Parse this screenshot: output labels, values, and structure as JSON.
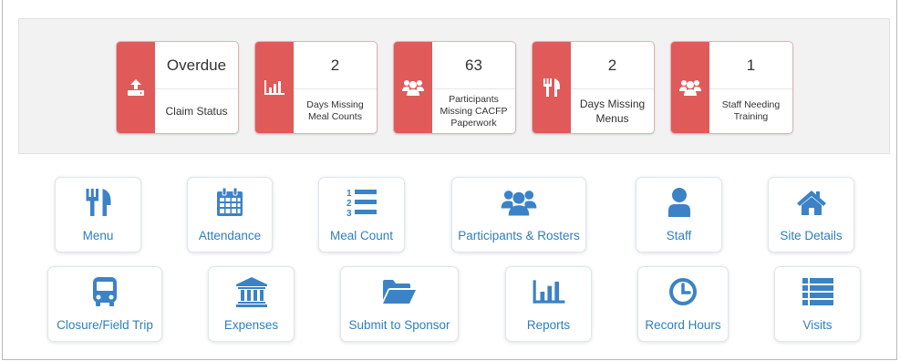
{
  "colors": {
    "accent_red": "#e05a5a",
    "link_blue": "#2f7ec0",
    "icon_blue": "#3b82c6",
    "panel_bg": "#f2f2f2"
  },
  "stats": [
    {
      "value": "Overdue",
      "label": "Claim Status",
      "icon": "upload-icon"
    },
    {
      "value": "2",
      "label": "Days Missing Meal Counts",
      "icon": "bar-chart-icon"
    },
    {
      "value": "63",
      "label": "Participants Missing CACFP Paperwork",
      "icon": "users-icon"
    },
    {
      "value": "2",
      "label": "Days Missing Menus",
      "icon": "utensils-icon"
    },
    {
      "value": "1",
      "label": "Staff Needing Training",
      "icon": "users-icon"
    }
  ],
  "nav_row1": [
    {
      "label": "Menu",
      "icon": "utensils-icon"
    },
    {
      "label": "Attendance",
      "icon": "calendar-icon"
    },
    {
      "label": "Meal Count",
      "icon": "numbered-list-icon"
    },
    {
      "label": "Participants & Rosters",
      "icon": "users-icon"
    },
    {
      "label": "Staff",
      "icon": "user-icon"
    },
    {
      "label": "Site Details",
      "icon": "home-icon"
    }
  ],
  "nav_row2": [
    {
      "label": "Closure/Field Trip",
      "icon": "bus-icon"
    },
    {
      "label": "Expenses",
      "icon": "bank-icon"
    },
    {
      "label": "Submit to Sponsor",
      "icon": "folder-open-icon"
    },
    {
      "label": "Reports",
      "icon": "bar-chart-icon"
    },
    {
      "label": "Record Hours",
      "icon": "clock-icon"
    },
    {
      "label": "Visits",
      "icon": "list-icon"
    }
  ]
}
